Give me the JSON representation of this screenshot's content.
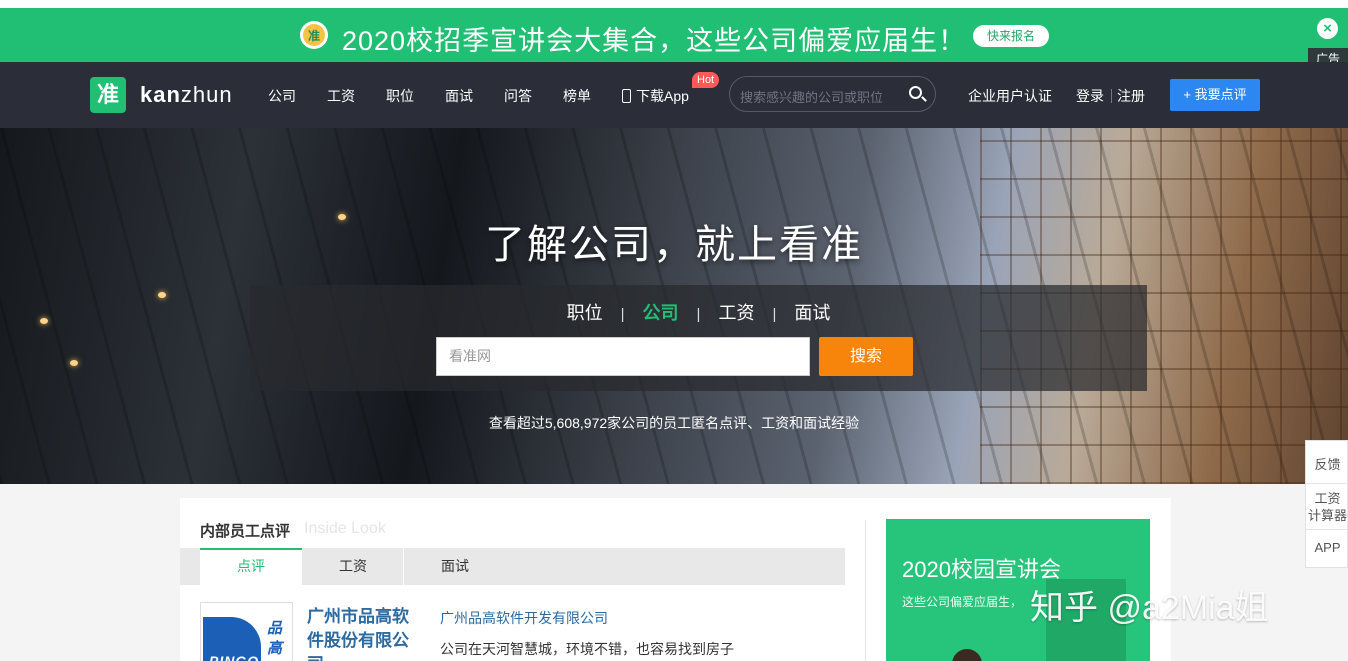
{
  "ad": {
    "text": "2020校招季宣讲会大集合，这些公司偏爱应届生！",
    "logo_char": "准",
    "button": "快来报名",
    "close": "×",
    "tag": "广告",
    "bg_color": "#21bf73"
  },
  "nav": {
    "logo_char": "准",
    "brand_bold": "kan",
    "brand_rest": "zhun",
    "items": [
      "公司",
      "工资",
      "职位",
      "面试",
      "问答",
      "榜单"
    ],
    "download": "下载App",
    "hot": "Hot",
    "search_placeholder": "搜索感兴趣的公司或职位",
    "enterprise": "企业用户认证",
    "login": "登录",
    "register": "注册",
    "review_button": "+ 我要点评",
    "accent": "#2d87f0"
  },
  "hero": {
    "title": "了解公司，就上看准",
    "tabs": [
      "职位",
      "公司",
      "工资",
      "面试"
    ],
    "tab_sep": "|",
    "active_tab": "公司",
    "search_value": "看准网",
    "search_button": "搜索",
    "stat": "查看超过5,608,972家公司的员工匿名点评、工资和面试经验",
    "button_color": "#f7840b"
  },
  "inside": {
    "title": "内部员工点评",
    "subtitle": "Inside Look",
    "tabs": [
      "点评",
      "工资",
      "面试"
    ],
    "company_logo_chars": [
      "品",
      "高"
    ],
    "company_logo_bottom": "PINGO",
    "company_name": "广州市品高软件股份有限公司",
    "review_company": "广州品高软件开发有限公司",
    "review_text": "公司在天河智慧城，环境不错，也容易找到房子"
  },
  "side_ad": {
    "title": "2020校园宣讲会",
    "subtitle": "这些公司偏爱应届生，"
  },
  "float": {
    "feedback": "反馈",
    "calc_line1": "工资",
    "calc_line2": "计算器",
    "app": "APP"
  },
  "watermark": "知乎 @a2Mia姐"
}
